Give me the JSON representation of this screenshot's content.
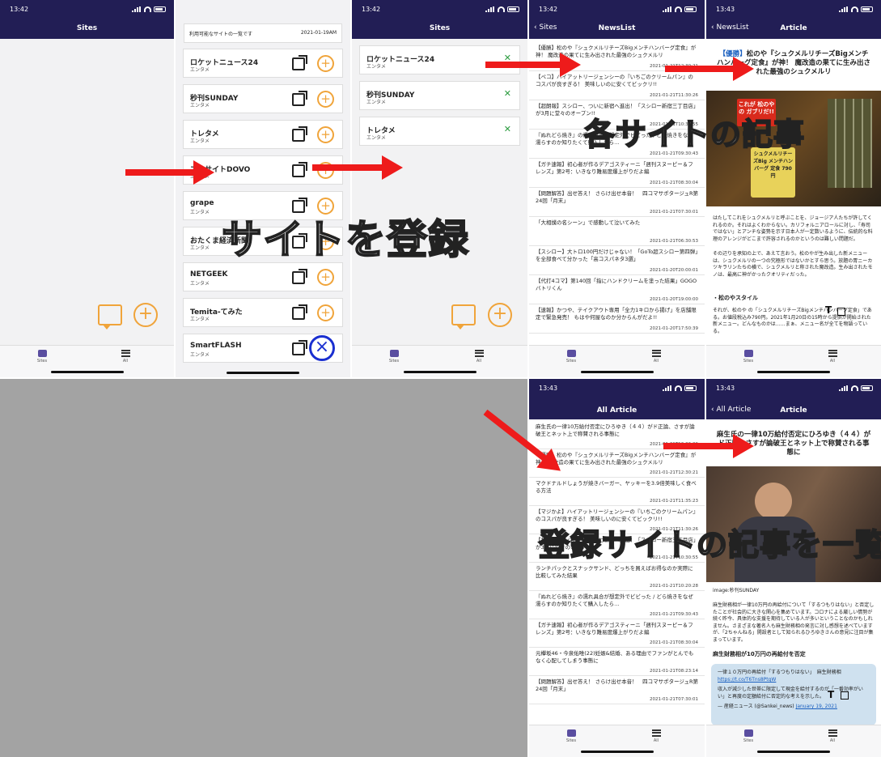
{
  "colors": {
    "nav": "#221e55",
    "accent": "#f0a43a",
    "arrow": "#ee1b1b",
    "check": "#2a9b3e",
    "link": "#1a5fbf"
  },
  "status": {
    "t1": "13:42",
    "t2": "13:42",
    "t3": "13:42",
    "t4": "13:42",
    "t5": "13:43",
    "t6": "13:43",
    "t7": "13:43"
  },
  "tabs": {
    "sites": "Sites",
    "all": "All"
  },
  "screen1": {
    "title": "Sites"
  },
  "screen2": {
    "header": "利用可能なサイトの一覧です",
    "date": "2021-01-19AM",
    "sites": [
      {
        "name": "ロケットニュース24",
        "cat": "エンタメ"
      },
      {
        "name": "秒刊SUNDAY",
        "cat": "エンタメ"
      },
      {
        "name": "トレタメ",
        "cat": "エンタメ"
      },
      {
        "name": "エキサイトDOVO",
        "cat": "エンタメ"
      },
      {
        "name": "grape",
        "cat": "エンタメ"
      },
      {
        "name": "おたくま経済新聞",
        "cat": "エンタメ"
      },
      {
        "name": "NETGEEK",
        "cat": "エンタメ"
      },
      {
        "name": "Temita-てみた",
        "cat": "エンタメ"
      },
      {
        "name": "SmartFLASH",
        "cat": "エンタメ"
      }
    ]
  },
  "screen3": {
    "title": "Sites",
    "sites": [
      {
        "name": "ロケットニュース24",
        "cat": "エンタメ"
      },
      {
        "name": "秒刊SUNDAY",
        "cat": "エンタメ"
      },
      {
        "name": "トレタメ",
        "cat": "エンタメ"
      }
    ]
  },
  "screen4": {
    "back": "Sites",
    "title": "NewsList",
    "items": [
      {
        "t": "【優勝】松のや『シュクメルリチーズBigメンチハンバーグ定食』が神！ 魔改造の果てに生み出された最強のシュクメルリ",
        "d": "2021-01-21T12:30:21"
      },
      {
        "t": "【ペコ】ハイアットリージェンシーの『いちごのクリームパン』のコスパが良すぎる！ 美味しいのに安くてビックリ!!",
        "d": "2021-01-21T11:30:26"
      },
      {
        "t": "【超朗報】スシロー、ついに新宿へ進出！「スシロー新宿三丁目店」が3月に堂々のオープン!!",
        "d": "2021-01-21T10:30:55"
      },
      {
        "t": "『ぬれどら焼き』の濡れ具合が想定外でビビった / どら焼きをなぜ濡らすのか知りたくて購入したら…",
        "d": "2021-01-21T09:30:43"
      },
      {
        "t": "【ガチ速報】初心者が作るデアゴスティーニ「週刊スヌーピー＆フレンズ」第2号：いきなり難易度爆上がりだよ編",
        "d": "2021-01-21T08:30:04"
      },
      {
        "t": "【問題解答】出せ答え！ さらけ出せ本音！　四コマサポタージュR第24回「月末」",
        "d": "2021-01-21T07:30:01"
      },
      {
        "t": "「大相撲の名シーン」で感動して泣いてみた",
        "d": "2021-01-21T06:30:53"
      },
      {
        "t": "【スシロー】大トロ100円だけじゃない！「GoTo超スシロー第四弾」を全部食べて分かった「高コスパネタ3選」",
        "d": "2021-01-20T20:00:01"
      },
      {
        "t": "【代打4コマ】第140回「指にハンドクリームを塗った結果」GOGOバトリくん",
        "d": "2021-01-20T19:00:00"
      },
      {
        "t": "【速報】かつや、テイクアウト専用「全力1キロから揚げ」を店舗限定で緊急発売！ もはや何屋なのか分からんがだよ!!",
        "d": "2021-01-20T17:50:39"
      }
    ]
  },
  "screen5": {
    "back": "NewsList",
    "title": "Article",
    "headline_src": "【優勝】",
    "headline": "松のや『シュクメルリチーズBigメンチハンバーグ定食』が神！ 魔改造の果てに生み出された最強のシュクメルリ",
    "photo_text": "これが 松のやの ガブリだ!!",
    "sign": "シュクメルリチーズBig メンチハンバーグ 定食 790円",
    "p1": "はたしてこれをシュクメルリと呼ぶことを、ジョージア人たちが許してくれるのか。それはよくわからない。カリフォルニアロールに対し、「寿司ではない」とアンチな姿勢を示す日本人が一定数いるように、伝統的な料理のアレンジがどこまで許容されるのかというのは難しい問題だ。",
    "p2": "その辺りを承知の上で、あえて言おう。松のやが生み出した新メニューは、シュクメルリの一つの究極形ではないかとすら思う。放題の胃ニーカツキラリンたちの横で、シュクメルリと称された魔改造。生み出されたモノは、最高に神がかったクオリティだった。",
    "sub": "・松のやスタイル",
    "p3": "それが、松のや の「シュクメルリチーズBigメンチハンバーグ定食」である。お値段税込み790円。2021年1月20日の15時から提供が開始された新メニュー。どんなものかは……まぁ、メニュー名が全てを物語っている。"
  },
  "screen6": {
    "title": "All Article",
    "items": [
      {
        "t": "麻生氏の一律10万給付否定にひろゆき（４４）がド正論、さすが論破王とネット上で称賛される事態に",
        "d": "2021-01-21T12:36:29"
      },
      {
        "t": "【優勝】松のや『シュクメルリチーズBigメンチハンバーグ定食』が神！ 魔改造の果てに生み出された最強のシュクメルリ",
        "d": "2021-01-21T12:30:21"
      },
      {
        "t": "マクドナルドしょうが焼きバーガー、ヤッキーを3.9倍美味しく食べる方法",
        "d": "2021-01-21T11:35:23"
      },
      {
        "t": "【マジかよ】ハイアットリージェンシーの『いちごのクリームパン』のコスパが良すぎる！ 美味しいのに安くてビックリ!!",
        "d": "2021-01-21T11:30:26"
      },
      {
        "t": "【超朗報】スシロー、ついに新宿へ進出！「スシロー新宿三丁目店」が3月に堂々のオープン!!",
        "d": "2021-01-21T10:30:55"
      },
      {
        "t": "ランチパックとスナックサンド、どっちを買えばお得なのか実際に比較してみた結果",
        "d": "2021-01-21T10:20:28"
      },
      {
        "t": "『ぬれどら焼き』の濡れ具合が想定外でビビった / どら焼きをなぜ濡らすのか知りたくて購入したら…",
        "d": "2021-01-21T09:30:43"
      },
      {
        "t": "【ガチ速報】初心者が作るデアゴスティーニ「週刊スヌーピー＆フレンズ」第2号：いきなり難易度爆上がりだよ編",
        "d": "2021-01-21T08:30:04"
      },
      {
        "t": "元欅坂46・今泉佑唯(22)妊娠&結婚、ある理由でファンがとんでもなく心配してしまう事態に",
        "d": "2021-01-21T08:23:14"
      },
      {
        "t": "【問題解答】出せ答え！ さらけ出せ本音！　四コマサポタージュR第24回「月末」",
        "d": "2021-01-21T07:30:01"
      }
    ]
  },
  "screen7": {
    "back": "All Article",
    "title": "Article",
    "headline": "麻生氏の一律10万給付否定にひろゆき（４４）がド正論、さすが論破王とネット上で称賛される事態に",
    "image_src": "image:秒刊SUNDAY",
    "p1": "麻生財務相が一律10万円の再給付について「するつもりはない」と否定したことが社会的に大きな関心を集めています。コロナによる厳しい情勢が続く昨今、具体的な支援を期待している人が多いということなのかもしれません。さまざまな著名人も麻生財務相の発言に対し感想を述べていますが、「2ちゃんねる」開設者として知られるひろゆきさんの意見に注目が集まっています。",
    "sub": "麻生財務相が10万円の再給付を否定",
    "tweet1": "一律１０万円の再給付「するつもりはない」　麻生財務相",
    "tweet_link": "https://t.co/T6Tns8PtgW",
    "tweet2": "収入が減少した世帯に限定して現金を給付するのが「一番効率がいい」と再度の定額給付に否定的な考えを示した。",
    "tweet3": "— 産経ニュース (@Sankei_news)",
    "tweet_date": "January 19, 2021"
  },
  "overlays": {
    "register": "サイトを登録",
    "articles": "各サイトの記事",
    "all": "登録サイトの記事を一覧"
  }
}
